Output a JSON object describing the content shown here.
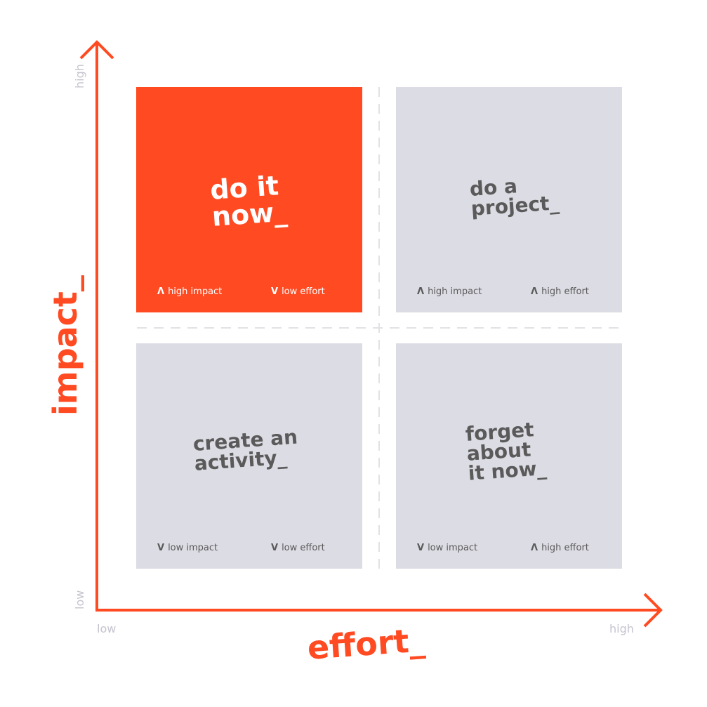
{
  "diagram": {
    "type": "2x2 priority matrix",
    "colors": {
      "accent": "#ff4a22",
      "quadrant_muted": "#dcdce4",
      "muted_text": "#5a5a5a",
      "tick_text": "#c4c4d0",
      "divider": "#e2e2e6"
    },
    "axes": {
      "x": {
        "title": "effort_",
        "low_label": "low",
        "high_label": "high"
      },
      "y": {
        "title": "impact_",
        "low_label": "low",
        "high_label": "high"
      }
    },
    "quadrants": [
      {
        "position": "top-left",
        "title": "do it\nnow_",
        "highlighted": true,
        "impact": {
          "glyph": "Λ",
          "label": "high impact"
        },
        "effort": {
          "glyph": "V",
          "label": "low effort"
        }
      },
      {
        "position": "top-right",
        "title": "do a\nproject_",
        "highlighted": false,
        "impact": {
          "glyph": "Λ",
          "label": "high impact"
        },
        "effort": {
          "glyph": "Λ",
          "label": "high effort"
        }
      },
      {
        "position": "bottom-left",
        "title": "create an\nactivity_",
        "highlighted": false,
        "impact": {
          "glyph": "V",
          "label": "low impact"
        },
        "effort": {
          "glyph": "V",
          "label": "low effort"
        }
      },
      {
        "position": "bottom-right",
        "title": "forget\nabout\nit now_",
        "highlighted": false,
        "impact": {
          "glyph": "V",
          "label": "low impact"
        },
        "effort": {
          "glyph": "Λ",
          "label": "high effort"
        }
      }
    ]
  }
}
